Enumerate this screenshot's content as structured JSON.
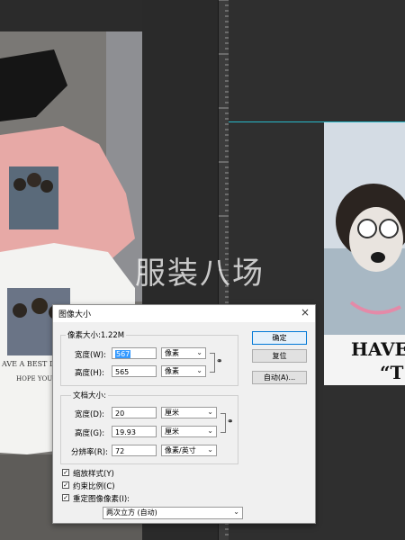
{
  "watermark": "服装八场",
  "right_doc": {
    "line1": "HAVE",
    "line2": "“T"
  },
  "dialog": {
    "title": "图像大小",
    "close": "×",
    "pixel_size": "像素大小:1.22M",
    "pixel": {
      "width_label": "宽度(W):",
      "width_value": "567",
      "width_unit": "像素",
      "height_label": "高度(H):",
      "height_value": "565",
      "height_unit": "像素"
    },
    "doc_size": {
      "group_label": "文档大小:",
      "width_label": "宽度(D):",
      "width_value": "20",
      "width_unit": "厘米",
      "height_label": "高度(G):",
      "height_value": "19.93",
      "height_unit": "厘米",
      "resolution_label": "分辨率(R):",
      "resolution_value": "72",
      "resolution_unit": "像素/英寸"
    },
    "buttons": {
      "ok": "确定",
      "reset": "复位",
      "auto": "自动(A)..."
    },
    "checkboxes": {
      "scale_styles": "缩放样式(Y)",
      "constrain": "约束比例(C)",
      "resample": "重定图像像素(I):"
    },
    "resample_method": "两次立方 (自动)",
    "link_glyph": "⚭"
  },
  "colors": {
    "guide": "#26b8c9",
    "dialog_bg": "#f0f0f0",
    "selection": "#3399ff"
  }
}
